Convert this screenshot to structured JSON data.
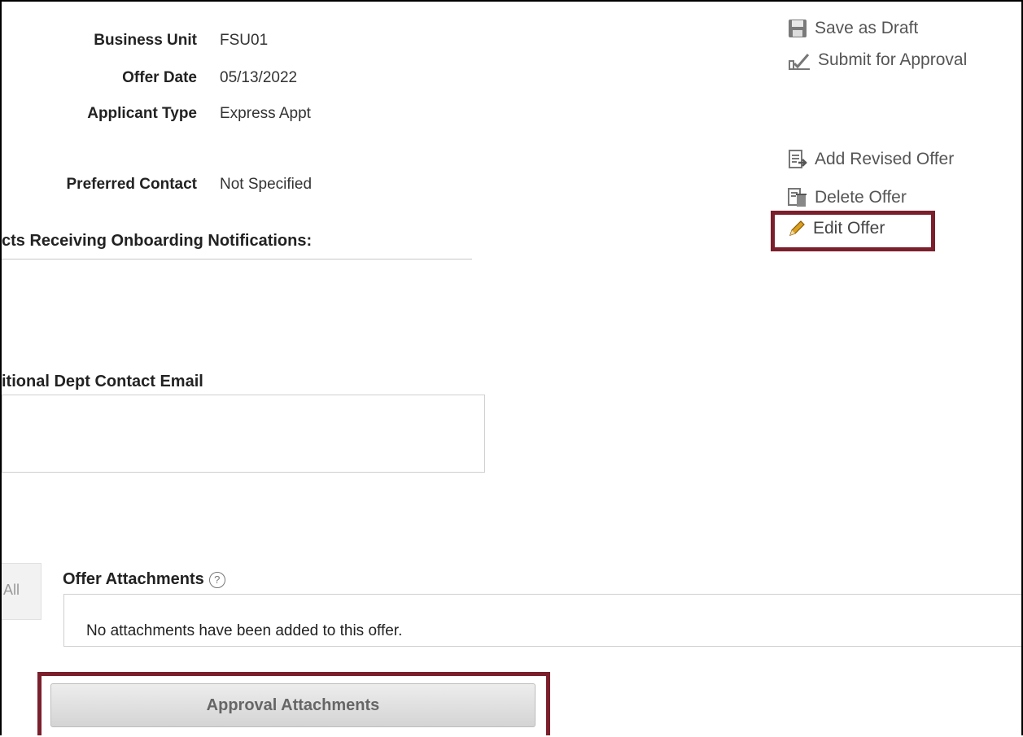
{
  "offer_fields": [
    {
      "label": "Business Unit",
      "value": "FSU01"
    },
    {
      "label": "Offer Date",
      "value": "05/13/2022"
    },
    {
      "label": "Applicant Type",
      "value": "Express Appt"
    },
    {
      "label": "Preferred Contact",
      "value": "Not Specified"
    }
  ],
  "actions": {
    "save_draft": "Save as Draft",
    "submit_approval": "Submit for Approval",
    "add_revised": "Add Revised Offer",
    "delete_offer": "Delete Offer",
    "edit_offer": "Edit Offer"
  },
  "sections": {
    "onboarding_title": "cts Receiving Onboarding Notifications:",
    "dept_contact_title": "itional Dept Contact Email",
    "dept_contact_value": ""
  },
  "attachments": {
    "side_tab": "All",
    "title": "Offer Attachments",
    "help": "?",
    "empty_message": "No attachments have been added to this offer."
  },
  "approval_button": "Approval Attachments",
  "colors": {
    "highlight": "#7a1f2b",
    "pencil": "#d9a021"
  }
}
